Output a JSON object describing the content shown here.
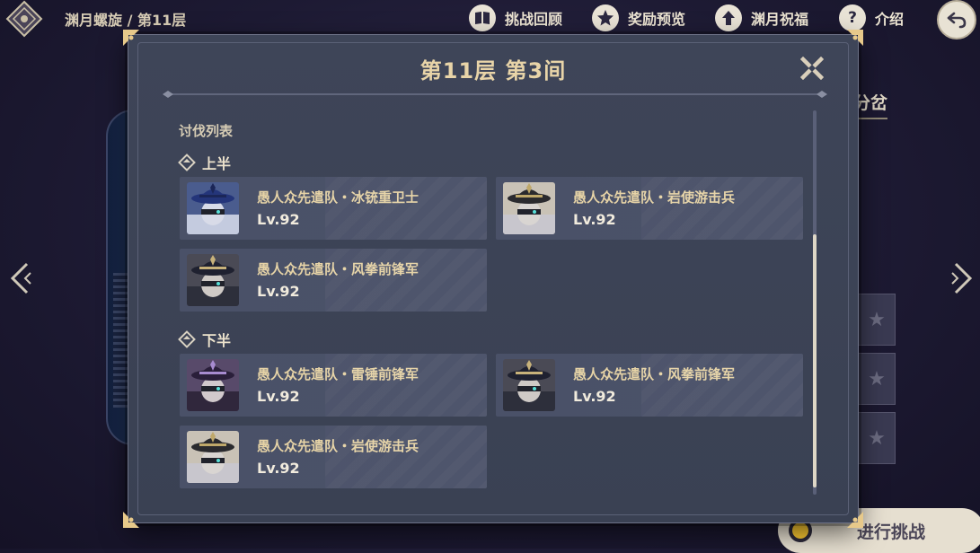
{
  "topbar": {
    "breadcrumb": "渊月螺旋 / 第11层",
    "buttons": [
      {
        "label": "挑战回顾",
        "icon": "book-icon"
      },
      {
        "label": "奖励预览",
        "icon": "star-badge-icon"
      },
      {
        "label": "渊月祝福",
        "icon": "upgrade-arrow-icon"
      },
      {
        "label": "介绍",
        "icon": "question-icon"
      }
    ],
    "help_glyph": "?"
  },
  "background": {
    "right_tab": "分岔",
    "start_button": "进行挑战",
    "star_glyph": "★"
  },
  "modal": {
    "title": "第11层 第3间",
    "section_label": "讨伐列表",
    "upper_label": "上半",
    "lower_label": "下半",
    "upper_enemies": [
      {
        "name": "愚人众先遣队・冰铳重卫士",
        "level": "Lv.92",
        "palette": "blue"
      },
      {
        "name": "愚人众先遣队・岩使游击兵",
        "level": "Lv.92",
        "palette": "grey"
      },
      {
        "name": "愚人众先遣队・风拳前锋军",
        "level": "Lv.92",
        "palette": "dark"
      }
    ],
    "lower_enemies": [
      {
        "name": "愚人众先遣队・雷锤前锋军",
        "level": "Lv.92",
        "palette": "purple"
      },
      {
        "name": "愚人众先遣队・风拳前锋军",
        "level": "Lv.92",
        "palette": "dark"
      },
      {
        "name": "愚人众先遣队・岩使游击兵",
        "level": "Lv.92",
        "palette": "grey"
      }
    ]
  },
  "colors": {
    "modal_bg": "#3c4356",
    "card_bg": "#4a5168",
    "title_gold": "#e8d4a8",
    "name_gold": "#e6d3a6"
  }
}
